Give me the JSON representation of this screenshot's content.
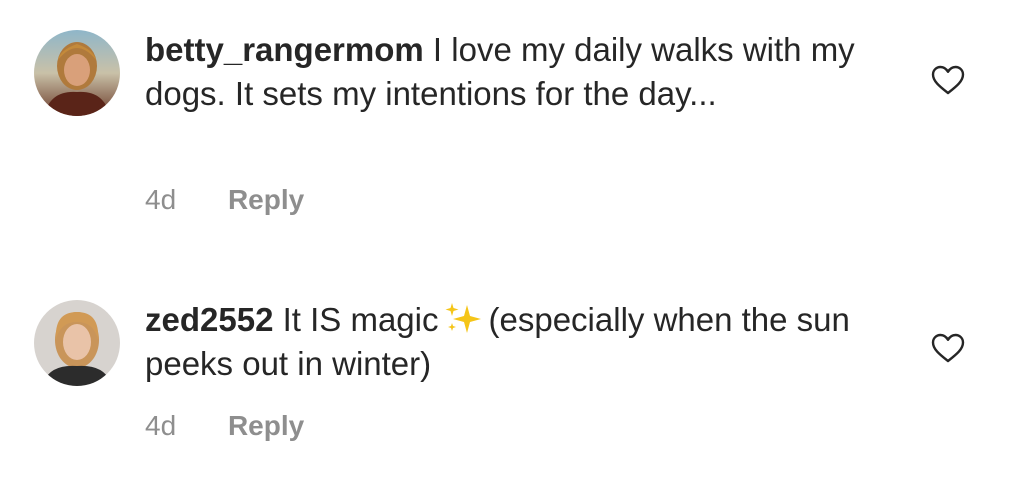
{
  "comments": [
    {
      "username": "betty_rangermom",
      "text": "I love my daily walks with my dogs. It sets my intentions for the day...",
      "time": "4d",
      "reply_label": "Reply"
    },
    {
      "username": "zed2552",
      "text_before": "It IS magic",
      "emoji": "sparkles-emoji",
      "text_after": "(especially when the sun peeks out in winter)",
      "time": "4d",
      "reply_label": "Reply"
    }
  ],
  "icons": {
    "like": "heart-outline-icon"
  },
  "colors": {
    "text": "#262626",
    "secondary": "#8e8e8e",
    "sparkle": "#f5c518"
  }
}
